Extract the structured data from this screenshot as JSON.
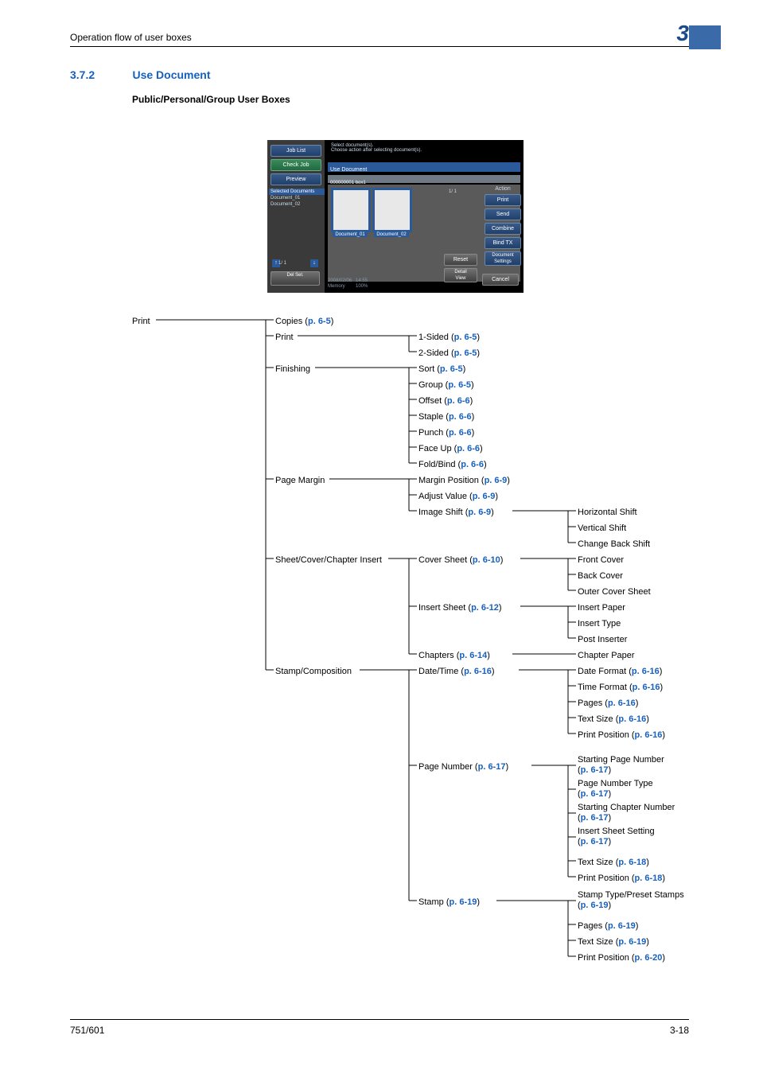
{
  "header": {
    "breadcrumb": "Operation flow of user boxes",
    "chapter": "3"
  },
  "section": {
    "number": "3.7.2",
    "title": "Use Document",
    "subheading": "Public/Personal/Group User Boxes"
  },
  "footer": {
    "left": "751/601",
    "right": "3-18"
  },
  "screenshot": {
    "sidepanel": {
      "job_list": "Job List",
      "check_job": "Check Job",
      "preview": "Preview",
      "selected_docs_header": "Selected Documents",
      "docs": [
        "Document_01",
        "Document_02"
      ],
      "page": "1/ 1",
      "del_btn": "Del\nSel."
    },
    "topmsg": "Select document(s).\nChoose action after selecting document(s).",
    "tab": "Use Document",
    "boxline": "000000001   box1",
    "doc_thumbs": [
      "Document_01",
      "Document_02"
    ],
    "page_ind": "1/ 1",
    "action_label": "Action",
    "action_buttons": [
      "Print",
      "Send",
      "Combine",
      "Bind TX",
      "Document\nSettings"
    ],
    "other_buttons": {
      "reset": "Reset",
      "detail": "Detail\nView",
      "cancel": "Cancel"
    },
    "statusbar": {
      "datetime": "2008/02/06   14:55",
      "memory": "Memory        100%"
    }
  },
  "tree": {
    "root": "Print",
    "copies": {
      "label": "Copies",
      "ref": "p. 6-5"
    },
    "print_node": {
      "label": "Print",
      "children": [
        {
          "label": "1-Sided",
          "ref": "p. 6-5"
        },
        {
          "label": "2-Sided",
          "ref": "p. 6-5"
        }
      ]
    },
    "finishing": {
      "label": "Finishing",
      "children": [
        {
          "label": "Sort",
          "ref": "p. 6-5"
        },
        {
          "label": "Group",
          "ref": "p. 6-5"
        },
        {
          "label": "Offset",
          "ref": "p. 6-6"
        },
        {
          "label": "Staple",
          "ref": "p. 6-6"
        },
        {
          "label": "Punch",
          "ref": "p. 6-6"
        },
        {
          "label": "Face Up",
          "ref": "p. 6-6"
        },
        {
          "label": "Fold/Bind",
          "ref": "p. 6-6"
        }
      ]
    },
    "page_margin": {
      "label": "Page Margin",
      "children": [
        {
          "label": "Margin Position",
          "ref": "p. 6-9"
        },
        {
          "label": "Adjust Value",
          "ref": "p. 6-9"
        },
        {
          "label": "Image Shift",
          "ref": "p. 6-9",
          "children": [
            {
              "label": "Horizontal Shift"
            },
            {
              "label": "Vertical Shift"
            },
            {
              "label": "Change Back Shift"
            }
          ]
        }
      ]
    },
    "sheet_cover": {
      "label": "Sheet/Cover/Chapter Insert",
      "children": [
        {
          "label": "Cover Sheet",
          "ref": "p. 6-10",
          "children": [
            {
              "label": "Front Cover"
            },
            {
              "label": "Back Cover"
            },
            {
              "label": "Outer Cover Sheet"
            }
          ]
        },
        {
          "label": "Insert Sheet",
          "ref": "p. 6-12",
          "children": [
            {
              "label": "Insert Paper"
            },
            {
              "label": "Insert Type"
            },
            {
              "label": "Post Inserter"
            }
          ]
        },
        {
          "label": "Chapters",
          "ref": "p. 6-14",
          "children": [
            {
              "label": "Chapter Paper"
            }
          ]
        }
      ]
    },
    "stamp": {
      "label": "Stamp/Composition",
      "children": [
        {
          "label": "Date/Time",
          "ref": "p. 6-16",
          "children": [
            {
              "label": "Date Format",
              "ref": "p. 6-16"
            },
            {
              "label": "Time Format",
              "ref": "p. 6-16"
            },
            {
              "label": "Pages",
              "ref": "p. 6-16"
            },
            {
              "label": "Text Size",
              "ref": "p. 6-16"
            },
            {
              "label": "Print Position",
              "ref": "p. 6-16"
            }
          ]
        },
        {
          "label": "Page Number",
          "ref": "p. 6-17",
          "children": [
            {
              "label": "Starting Page Number",
              "ref": "p. 6-17"
            },
            {
              "label": "Page Number Type",
              "ref": "p. 6-17"
            },
            {
              "label": "Starting Chapter Number",
              "ref": "p. 6-17"
            },
            {
              "label": "Insert Sheet Setting",
              "ref": "p. 6-17"
            },
            {
              "label": "Text Size",
              "ref": "p. 6-18"
            },
            {
              "label": "Print Position",
              "ref": "p. 6-18"
            }
          ]
        },
        {
          "label": "Stamp",
          "ref": "p. 6-19",
          "children": [
            {
              "label": "Stamp Type/Preset Stamps",
              "ref": "p. 6-19"
            },
            {
              "label": "Pages",
              "ref": "p. 6-19"
            },
            {
              "label": "Text Size",
              "ref": "p. 6-19"
            },
            {
              "label": "Print Position",
              "ref": "p. 6-20"
            }
          ]
        }
      ]
    }
  }
}
